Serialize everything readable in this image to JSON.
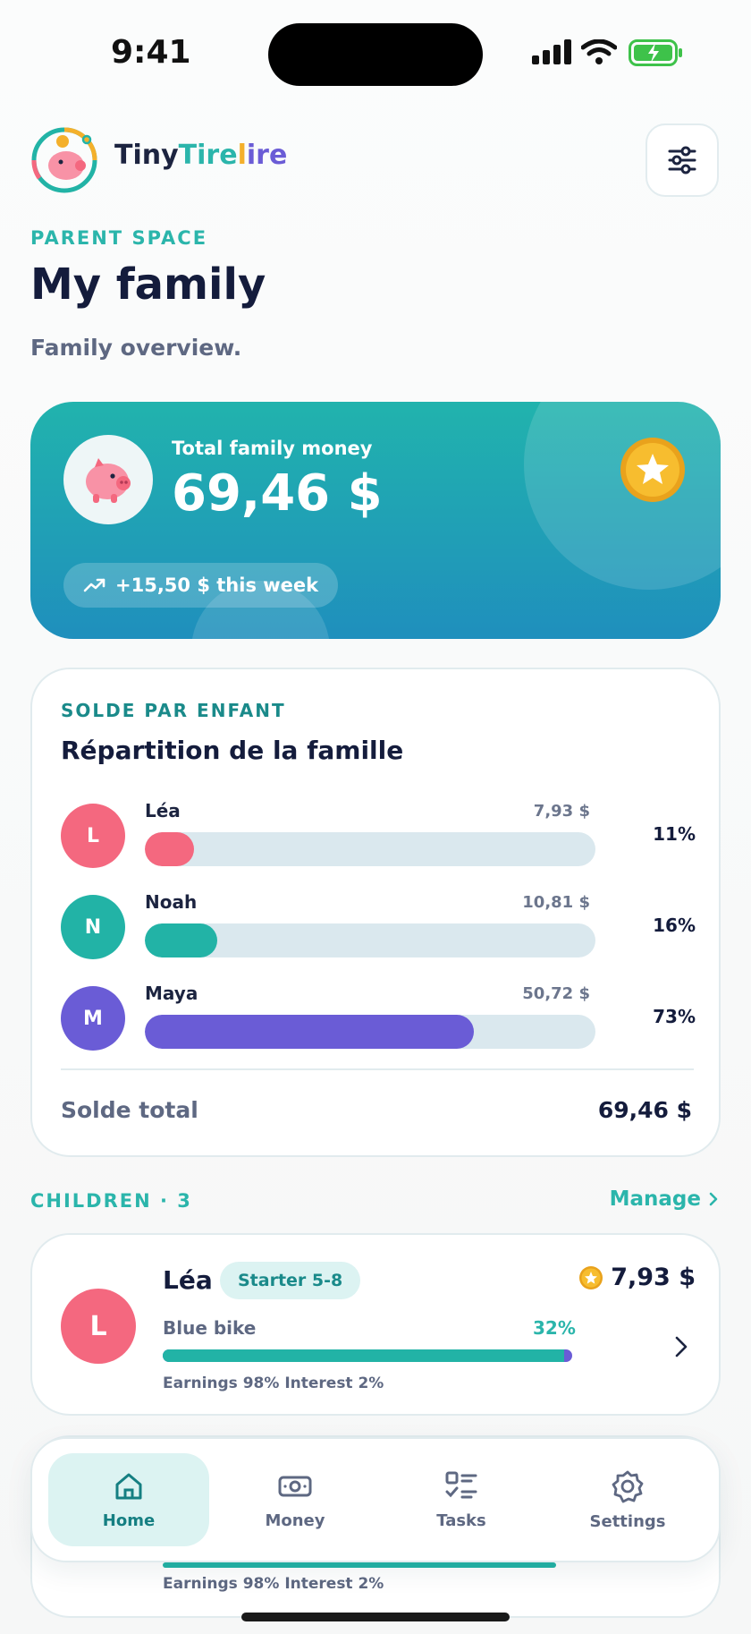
{
  "status": {
    "time": "9:41"
  },
  "brand": {
    "part1": "Tiny",
    "part2": "Tire",
    "part3": "l",
    "part4": "ire"
  },
  "header": {
    "eyebrow": "PARENT SPACE",
    "title": "My family",
    "subtitle": "Family overview."
  },
  "hero": {
    "label": "Total family money",
    "amount": "69,46 $",
    "week_change": "+15,50 $ this week"
  },
  "split": {
    "eyebrow": "SOLDE PAR ENFANT",
    "title": "Répartition de la famille",
    "rows": [
      {
        "initial": "L",
        "name": "Léa",
        "amount": "7,93 $",
        "percent_label": "11%",
        "percent": 11,
        "color": "#f4687f"
      },
      {
        "initial": "N",
        "name": "Noah",
        "amount": "10,81 $",
        "percent_label": "16%",
        "percent": 16,
        "color": "#22b3a6"
      },
      {
        "initial": "M",
        "name": "Maya",
        "amount": "50,72 $",
        "percent_label": "73%",
        "percent": 73,
        "color": "#6a5cd6"
      }
    ],
    "total_label": "Solde total",
    "total_value": "69,46 $"
  },
  "children": {
    "heading": "CHILDREN · 3",
    "manage_label": "Manage",
    "cards": [
      {
        "initial": "L",
        "name": "Léa",
        "tag": "Starter 5-8",
        "goal": "Blue bike",
        "goal_percent_label": "32%",
        "goal_earnings_fraction": 0.98,
        "balance": "7,93 $",
        "meta": "Earnings 98%  Interest 2%"
      },
      {
        "meta": "Earnings 98%  Interest 2%"
      }
    ]
  },
  "tabs": [
    {
      "label": "Home",
      "icon": "home-icon",
      "active": true
    },
    {
      "label": "Money",
      "icon": "money-icon",
      "active": false
    },
    {
      "label": "Tasks",
      "icon": "tasks-icon",
      "active": false
    },
    {
      "label": "Settings",
      "icon": "settings-icon",
      "active": false
    }
  ],
  "colors": {
    "accent": "#2bb5ab",
    "hero_top": "#21b3ad",
    "hero_bottom": "#1f8fbd",
    "navy": "#141c3c"
  }
}
